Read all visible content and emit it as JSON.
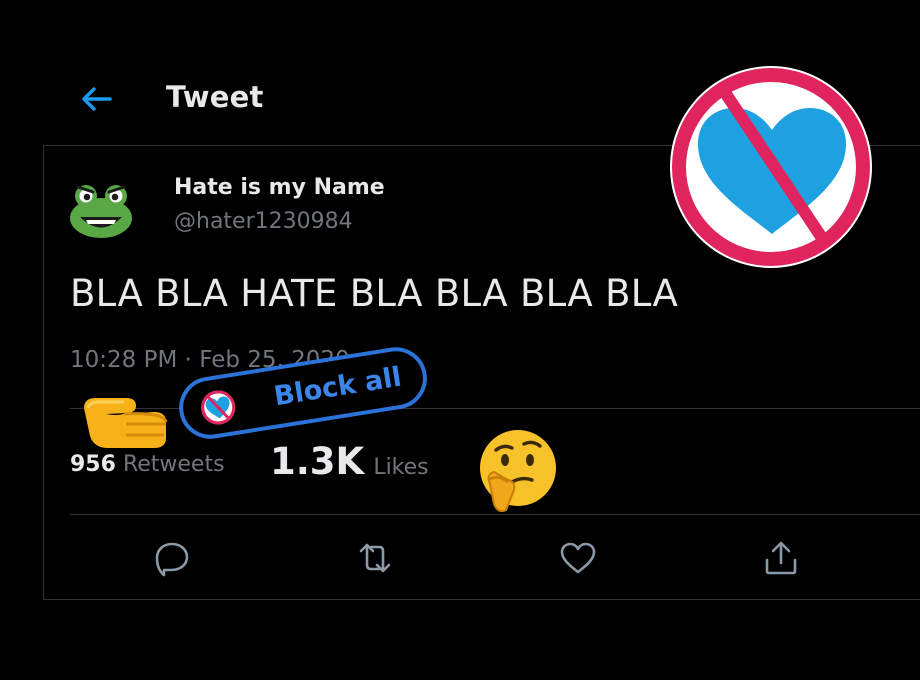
{
  "header": {
    "title": "Tweet"
  },
  "tweet": {
    "display_name": "Hate is my Name",
    "handle": "@hater1230984",
    "text": "BLA BLA  HATE BLA BLA BLA BLA",
    "timestamp": "10:28 PM · Feb 25, 2020"
  },
  "stats": {
    "retweets_count": "956",
    "retweets_label": "Retweets",
    "likes_count": "1.3K",
    "likes_label": "Likes"
  },
  "actions": [
    "reply-icon",
    "retweet-icon",
    "like-icon",
    "share-icon"
  ],
  "sticker": {
    "label": "Block all"
  },
  "colors": {
    "accent": "#1d9bf0",
    "no_symbol": "#e0245e",
    "heart": "#1da1e0",
    "sticker_blue": "#2b73d8"
  }
}
